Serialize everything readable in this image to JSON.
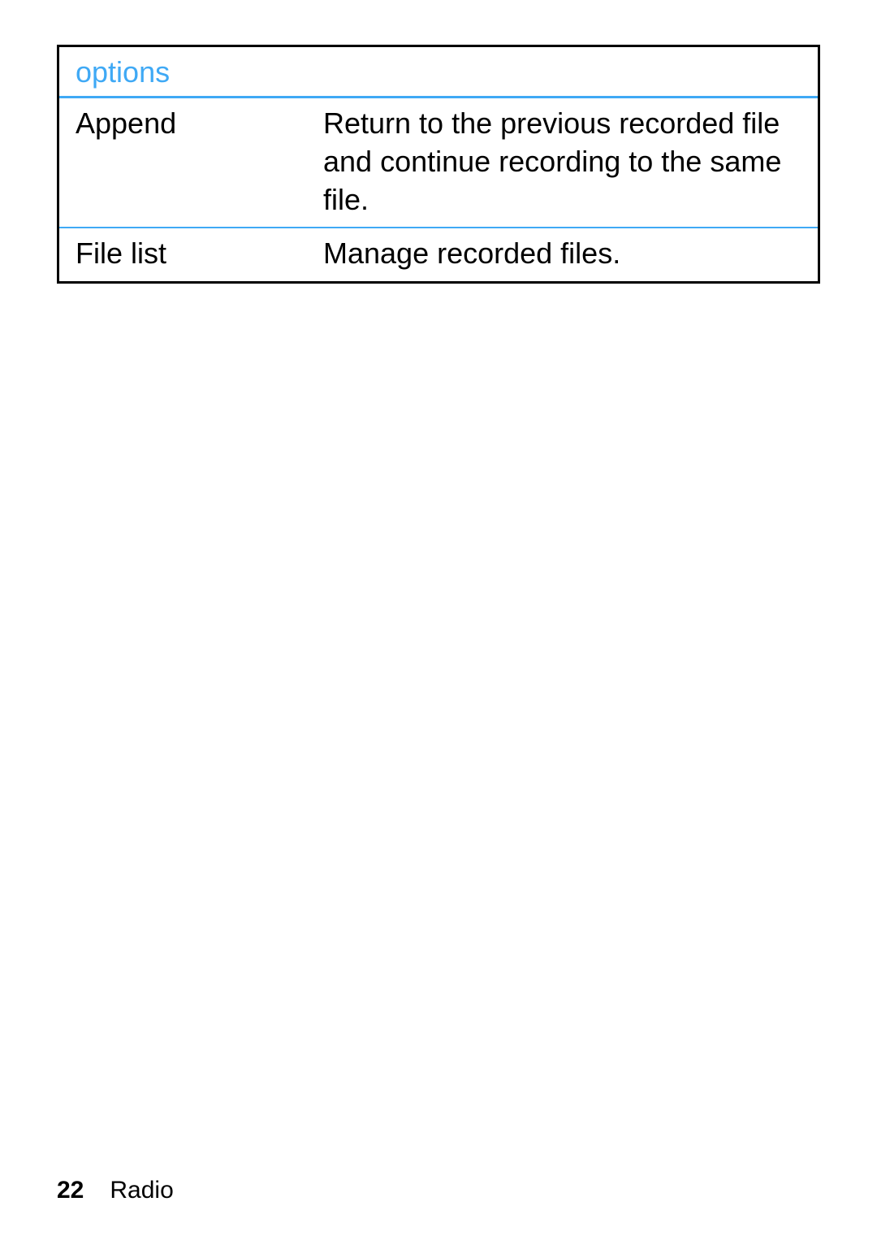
{
  "table": {
    "header": "options",
    "rows": [
      {
        "label": "Append",
        "description": "Return to the previous recorded file and continue recording to the same file."
      },
      {
        "label": "File list",
        "description": "Manage recorded files."
      }
    ]
  },
  "footer": {
    "page_number": "22",
    "section": "Radio"
  }
}
